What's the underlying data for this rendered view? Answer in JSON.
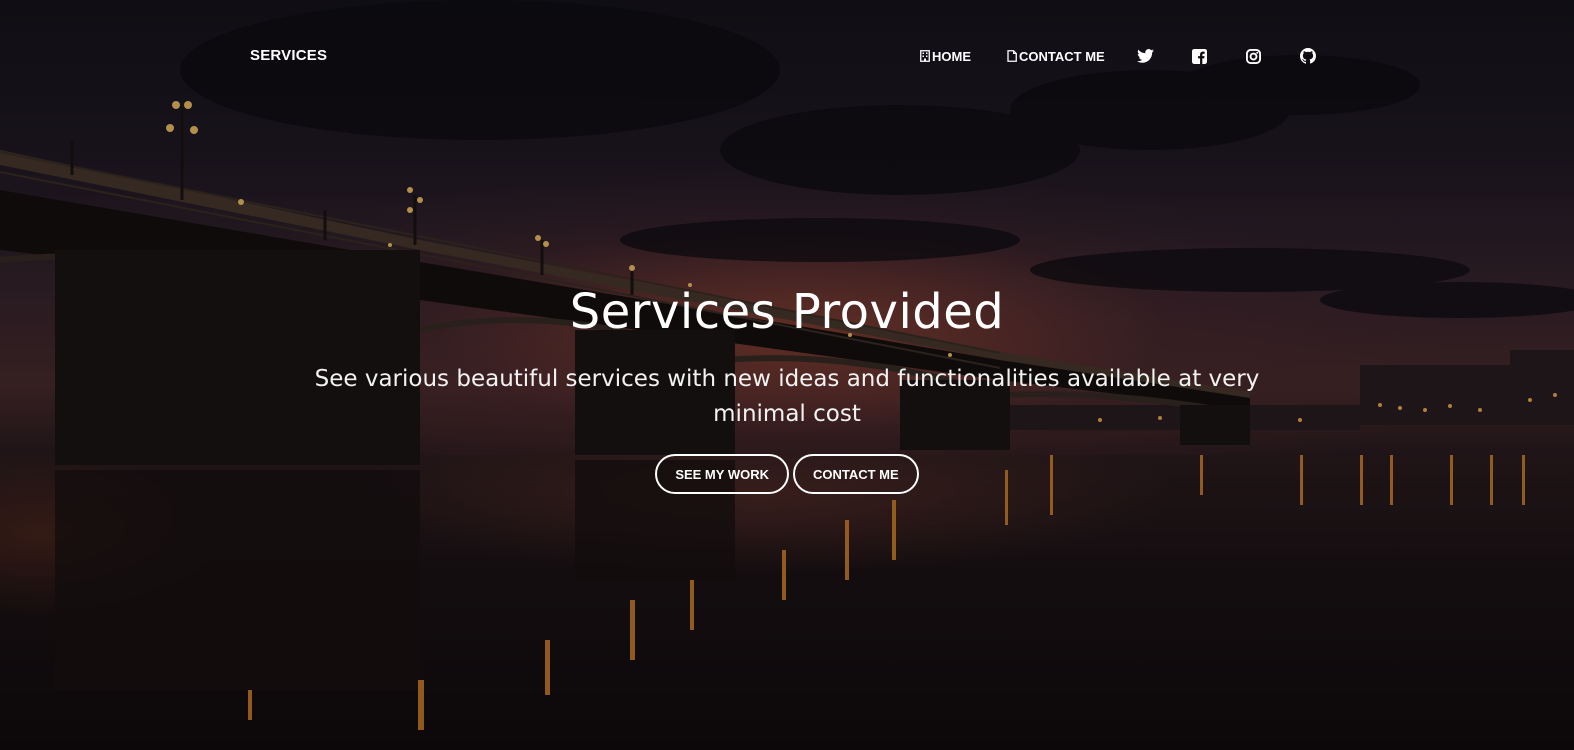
{
  "nav": {
    "brand": "SERVICES",
    "home_label": "HOME",
    "contact_label": "CONTACT ME",
    "social_icons": [
      "twitter-icon",
      "facebook-icon",
      "instagram-icon",
      "github-icon"
    ]
  },
  "hero": {
    "title": "Services Provided",
    "subtitle": "See various beautiful services with new ideas and functionalities available at very minimal cost",
    "primary_button": "SEE MY WORK",
    "secondary_button": "CONTACT ME"
  },
  "colors": {
    "text": "#ffffff",
    "sky_glow": "#96463a",
    "lamp_light": "#f0a040"
  }
}
